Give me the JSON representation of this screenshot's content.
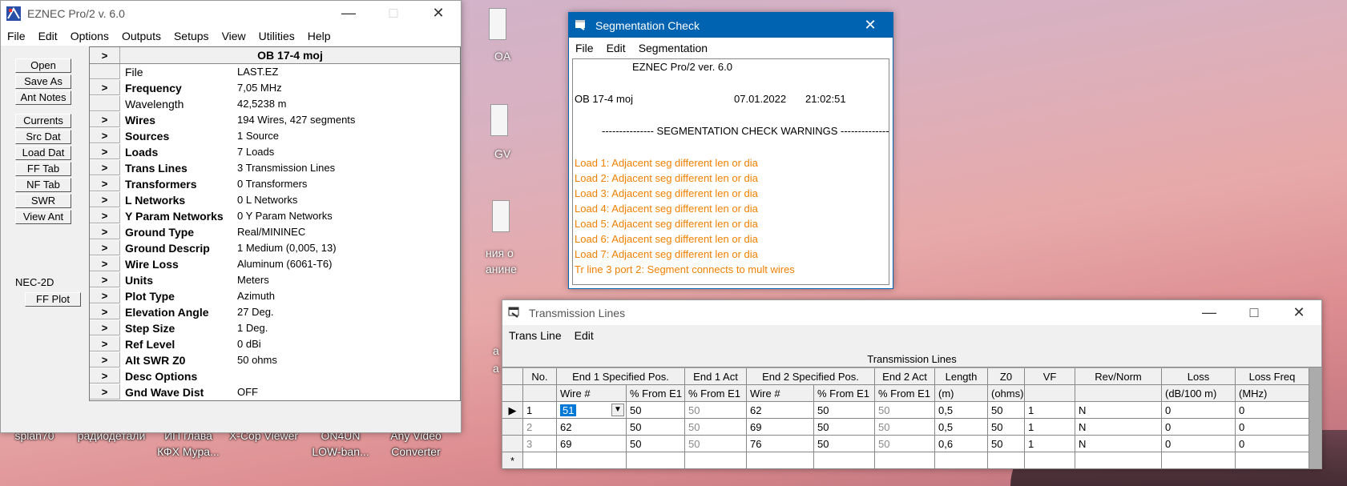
{
  "desktop": {
    "icons": [
      {
        "label": "splan70"
      },
      {
        "label": "радиодетали"
      },
      {
        "label": "ИП глава\nКФХ Мура..."
      },
      {
        "label": "X-Cop Viewer"
      },
      {
        "label": "ON4UN\nLOW-ban..."
      },
      {
        "label": "Any Video\nConverter"
      }
    ],
    "side_labels": [
      "OA",
      "GV",
      "ния о",
      "анине",
      "a",
      "a"
    ]
  },
  "eznec": {
    "title": "EZNEC Pro/2  v. 6.0",
    "menu": [
      "File",
      "Edit",
      "Options",
      "Outputs",
      "Setups",
      "View",
      "Utilities",
      "Help"
    ],
    "buttons_top": [
      "Open",
      "Save As",
      "Ant Notes"
    ],
    "buttons_mid": [
      "Currents",
      "Src Dat",
      "Load Dat",
      "FF Tab",
      "NF Tab",
      "SWR",
      "View Ant"
    ],
    "nec_label": "NEC-2D",
    "ffplot": "FF Plot",
    "grid_title": "OB 17-4 moj",
    "grid_title_arrow": ">",
    "rows": [
      {
        "arrow": "",
        "label": "File",
        "value": "LAST.EZ",
        "bold": false
      },
      {
        "arrow": ">",
        "label": "Frequency",
        "value": "7,05 MHz",
        "bold": true
      },
      {
        "arrow": "",
        "label": "Wavelength",
        "value": "42,5238 m",
        "bold": false
      },
      {
        "arrow": ">",
        "label": "Wires",
        "value": "194 Wires, 427 segments",
        "bold": true
      },
      {
        "arrow": ">",
        "label": "Sources",
        "value": "1 Source",
        "bold": true
      },
      {
        "arrow": ">",
        "label": "Loads",
        "value": "7 Loads",
        "bold": true
      },
      {
        "arrow": ">",
        "label": "Trans Lines",
        "value": "3 Transmission Lines",
        "bold": true
      },
      {
        "arrow": ">",
        "label": "Transformers",
        "value": "0 Transformers",
        "bold": true
      },
      {
        "arrow": ">",
        "label": "L Networks",
        "value": "0 L Networks",
        "bold": true
      },
      {
        "arrow": ">",
        "label": "Y Param Networks",
        "value": "0 Y Param Networks",
        "bold": true
      },
      {
        "arrow": ">",
        "label": "Ground Type",
        "value": "Real/MININEC",
        "bold": true
      },
      {
        "arrow": ">",
        "label": "Ground Descrip",
        "value": "1 Medium (0,005, 13)",
        "bold": true
      },
      {
        "arrow": ">",
        "label": "Wire Loss",
        "value": "Aluminum (6061-T6)",
        "bold": true
      },
      {
        "arrow": ">",
        "label": "Units",
        "value": "Meters",
        "bold": true
      },
      {
        "arrow": ">",
        "label": "Plot Type",
        "value": "Azimuth",
        "bold": true
      },
      {
        "arrow": ">",
        "label": "Elevation Angle",
        "value": "27 Deg.",
        "bold": true
      },
      {
        "arrow": ">",
        "label": "Step Size",
        "value": "1 Deg.",
        "bold": true
      },
      {
        "arrow": ">",
        "label": "Ref Level",
        "value": "0 dBi",
        "bold": true
      },
      {
        "arrow": ">",
        "label": "Alt SWR Z0",
        "value": "50 ohms",
        "bold": true
      },
      {
        "arrow": ">",
        "label": "Desc Options",
        "value": "",
        "bold": true
      },
      {
        "arrow": ">",
        "label": "Gnd Wave Dist",
        "value": "OFF",
        "bold": true
      }
    ]
  },
  "seg": {
    "title": "Segmentation Check",
    "menu": [
      "File",
      "Edit",
      "Segmentation"
    ],
    "version": "EZNEC Pro/2 ver. 6.0",
    "model": "OB 17-4 moj",
    "date": "07.01.2022",
    "time": "21:02:51",
    "header": "--------------- SEGMENTATION CHECK WARNINGS ---------------",
    "warnings": [
      "Load 1: Adjacent seg different len or dia",
      "Load 2: Adjacent seg different len or dia",
      "Load 3: Adjacent seg different len or dia",
      "Load 4: Adjacent seg different len or dia",
      "Load 5: Adjacent seg different len or dia",
      "Load 6: Adjacent seg different len or dia",
      "Load 7: Adjacent seg different len or dia",
      "Tr line 3 port 2: Segment connects to mult wires"
    ],
    "warning_color": "#f08000"
  },
  "tl": {
    "title": "Transmission Lines",
    "menu": [
      "Trans Line",
      "Edit"
    ],
    "caption": "Transmission Lines",
    "headers": [
      "No.",
      "End 1 Specified Pos.",
      "End 1 Act",
      "End 2 Specified Pos.",
      "End 2 Act",
      "Length",
      "Z0",
      "VF",
      "Rev/Norm",
      "Loss",
      "Loss Freq"
    ],
    "subheaders": [
      "",
      "Wire #",
      "% From E1",
      "% From E1",
      "Wire #",
      "% From E1",
      "% From E1",
      "(m)",
      "(ohms)",
      "",
      "",
      "(dB/100 m)",
      "(MHz)"
    ],
    "rows": [
      [
        "1",
        "51",
        "50",
        "50",
        "62",
        "50",
        "50",
        "0,5",
        "50",
        "1",
        "N",
        "0",
        "0"
      ],
      [
        "2",
        "62",
        "50",
        "50",
        "69",
        "50",
        "50",
        "0,5",
        "50",
        "1",
        "N",
        "0",
        "0"
      ],
      [
        "3",
        "69",
        "50",
        "50",
        "76",
        "50",
        "50",
        "0,6",
        "50",
        "1",
        "N",
        "0",
        "0"
      ]
    ],
    "new_row_marker": "*",
    "current_row_marker": "▶"
  }
}
